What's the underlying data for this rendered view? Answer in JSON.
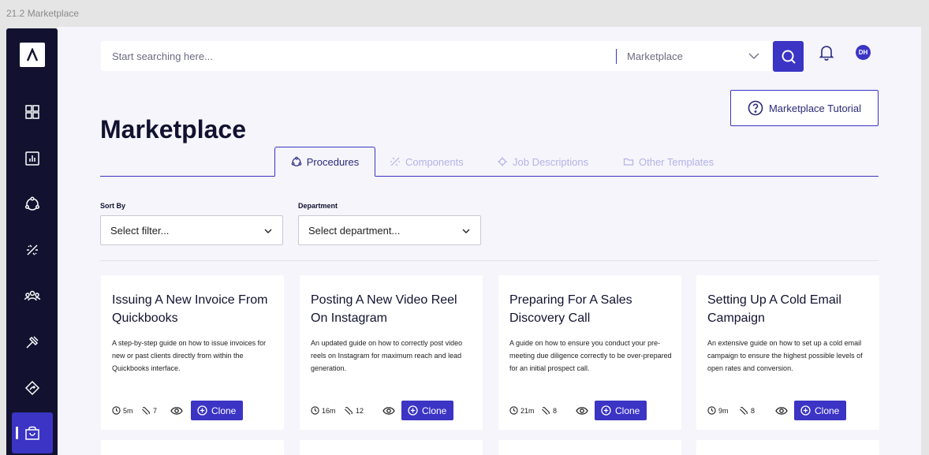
{
  "frame_label": "21.2 Marketplace",
  "search": {
    "placeholder": "Start searching here...",
    "scope": "Marketplace"
  },
  "user": {
    "initials": "DH"
  },
  "tutorial_label": "Marketplace Tutorial",
  "page_title": "Marketplace",
  "tabs": [
    {
      "label": "Procedures",
      "icon": "procedures-icon",
      "active": true
    },
    {
      "label": "Components",
      "icon": "components-icon",
      "active": false
    },
    {
      "label": "Job Descriptions",
      "icon": "job-descriptions-icon",
      "active": false
    },
    {
      "label": "Other Templates",
      "icon": "folder-icon",
      "active": false
    }
  ],
  "filters": {
    "sort_label": "Sort By",
    "sort_value": "Select filter...",
    "department_label": "Department",
    "department_value": "Select department..."
  },
  "clone_label": "Clone",
  "cards": [
    {
      "title": "Issuing A New Invoice From Quickbooks",
      "description": "A step-by-step guide on how to issue invoices for new or past clients directly from within the Quickbooks interface.",
      "duration": "5m",
      "components": "7"
    },
    {
      "title": "Posting A New Video Reel On Instagram",
      "description": "An updated guide on how to correctly post video reels on Instagram for maximum reach and lead generation.",
      "duration": "16m",
      "components": "12"
    },
    {
      "title": "Preparing For A Sales Discovery Call",
      "description": "A guide on how to ensure you conduct your pre-meeting due diligence correctly to be over-prepared for an initial prospect call.",
      "duration": "21m",
      "components": "8"
    },
    {
      "title": "Setting Up A Cold Email Campaign",
      "description": "An extensive guide on how to set up a cold email campaign to ensure the highest possible levels of open rates and conversion.",
      "duration": "9m",
      "components": "8"
    }
  ],
  "colors": {
    "accent": "#3b34c4",
    "sidebar": "#121230",
    "background": "#f5f5fb"
  },
  "sidebar_icons": [
    "logo-icon",
    "dashboard-icon",
    "analytics-icon",
    "procedures-icon",
    "components-icon",
    "team-icon",
    "tools-icon",
    "processes-icon",
    "marketplace-icon"
  ]
}
